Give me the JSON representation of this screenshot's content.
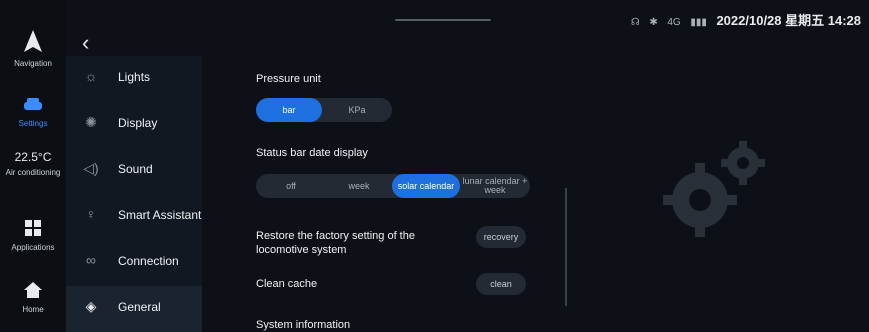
{
  "status_bar": {
    "icons": [
      "location-icon",
      "bluetooth-icon"
    ],
    "network": "4G",
    "date_time": "2022/10/28 星期五 14:28"
  },
  "dock": {
    "navigation": "Navigation",
    "settings": "Settings",
    "temperature": "22.5°C",
    "air_conditioning": "Air conditioning",
    "applications": "Applications",
    "home": "Home"
  },
  "menu": [
    {
      "label": "Lights",
      "icon": "sun-icon"
    },
    {
      "label": "Display",
      "icon": "brightness-icon"
    },
    {
      "label": "Sound",
      "icon": "speaker-icon"
    },
    {
      "label": "Smart Assistant",
      "icon": "microphone-icon"
    },
    {
      "label": "Connection",
      "icon": "link-icon"
    },
    {
      "label": "General",
      "icon": "layers-icon"
    }
  ],
  "settings": {
    "pressure_unit": {
      "label": "Pressure unit",
      "options": [
        "bar",
        "KPa"
      ],
      "selected": "bar"
    },
    "status_bar_date": {
      "label": "Status bar date display",
      "options": [
        "off",
        "week",
        "solar calendar",
        "lunar calendar + week"
      ],
      "selected": "solar calendar"
    },
    "restore": {
      "label": "Restore the factory setting of the locomotive system",
      "button": "recovery"
    },
    "clean_cache": {
      "label": "Clean cache",
      "button": "clean"
    },
    "system_info": {
      "label": "System information"
    }
  }
}
